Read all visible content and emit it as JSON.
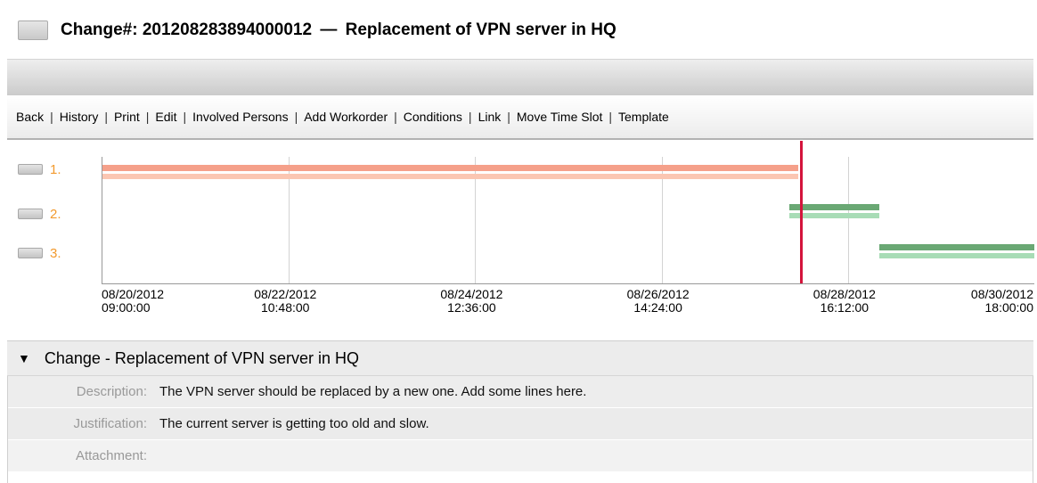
{
  "title": {
    "change_label": "Change#:",
    "change_number": "201208283894000012",
    "separator": "—",
    "change_name": "Replacement of VPN server in HQ"
  },
  "toolbar": {
    "items": [
      "Back",
      "History",
      "Print",
      "Edit",
      "Involved Persons",
      "Add Workorder",
      "Conditions",
      "Link",
      "Move Time Slot",
      "Template"
    ],
    "separator": "|"
  },
  "gantt": {
    "rows": [
      {
        "label": "1.",
        "start": "08/20/2012 09:00",
        "end": "08/28/2012 03:00",
        "planned_color": "#f5a08a",
        "actual_color": "#fbc6b2"
      },
      {
        "label": "2.",
        "start": "08/28/2012 00:30",
        "end": "08/29/2012 00:30",
        "planned_color": "#6aa874",
        "actual_color": "#a8dcb6"
      },
      {
        "label": "3.",
        "start": "08/29/2012 00:30",
        "end": "08/30/2012 18:00",
        "planned_color": "#6aa874",
        "actual_color": "#a8dcb6"
      }
    ],
    "current_time": "08/28/2012 03:40",
    "current_time_color": "#d4143c",
    "ticks": [
      {
        "date": "08/20/2012",
        "time": "09:00:00"
      },
      {
        "date": "08/22/2012",
        "time": "10:48:00"
      },
      {
        "date": "08/24/2012",
        "time": "12:36:00"
      },
      {
        "date": "08/26/2012",
        "time": "14:24:00"
      },
      {
        "date": "08/28/2012",
        "time": "16:12:00"
      },
      {
        "date": "08/30/2012",
        "time": "18:00:00"
      }
    ]
  },
  "section": {
    "toggle_icon": "triangle-down-icon",
    "toggle_glyph": "▼",
    "title": "Change - Replacement of VPN server in HQ",
    "fields": [
      {
        "label": "Description:",
        "value": "The VPN server should be replaced by a new one. Add some lines here."
      },
      {
        "label": "Justification:",
        "value": "The current server is getting too old and slow."
      },
      {
        "label": "Attachment:",
        "value": ""
      }
    ]
  }
}
